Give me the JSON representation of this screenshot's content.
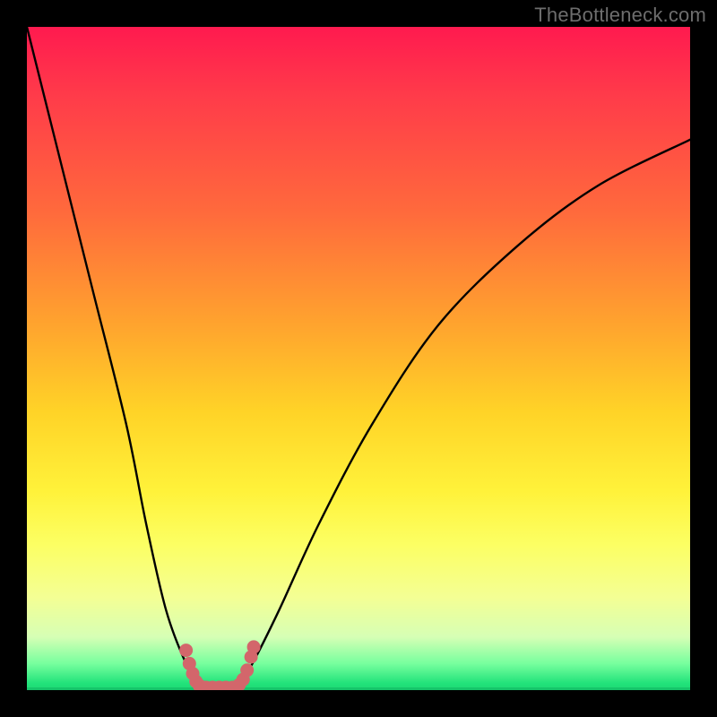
{
  "watermark": {
    "text": "TheBottleneck.com"
  },
  "chart_data": {
    "type": "line",
    "title": "",
    "xlabel": "",
    "ylabel": "",
    "xlim": [
      0,
      100
    ],
    "ylim": [
      0,
      100
    ],
    "background_gradient": {
      "direction": "vertical",
      "stops": [
        {
          "pos": 0,
          "color": "#ff1a4f"
        },
        {
          "pos": 28,
          "color": "#ff6a3c"
        },
        {
          "pos": 58,
          "color": "#ffd327"
        },
        {
          "pos": 78,
          "color": "#fcff63"
        },
        {
          "pos": 92,
          "color": "#d6ffb5"
        },
        {
          "pos": 100,
          "color": "#1fd874"
        }
      ]
    },
    "series": [
      {
        "name": "bottleneck-curve",
        "color": "#000000",
        "x": [
          0,
          5,
          10,
          15,
          18,
          21,
          24,
          26,
          28,
          30,
          32,
          34,
          38,
          44,
          52,
          62,
          74,
          86,
          100
        ],
        "values": [
          100,
          80,
          60,
          40,
          25,
          12,
          4,
          1,
          0,
          0,
          1,
          4,
          12,
          25,
          40,
          55,
          67,
          76,
          83
        ]
      }
    ],
    "markers": [
      {
        "name": "min-region-dots",
        "color": "#d3666b",
        "points": [
          {
            "x": 24.0,
            "y": 6.0
          },
          {
            "x": 24.5,
            "y": 4.0
          },
          {
            "x": 25.0,
            "y": 2.5
          },
          {
            "x": 25.5,
            "y": 1.3
          },
          {
            "x": 26.0,
            "y": 0.7
          },
          {
            "x": 27.0,
            "y": 0.4
          },
          {
            "x": 28.0,
            "y": 0.4
          },
          {
            "x": 29.0,
            "y": 0.4
          },
          {
            "x": 30.0,
            "y": 0.4
          },
          {
            "x": 31.0,
            "y": 0.4
          },
          {
            "x": 32.0,
            "y": 0.8
          },
          {
            "x": 32.6,
            "y": 1.6
          },
          {
            "x": 33.2,
            "y": 3.0
          },
          {
            "x": 33.8,
            "y": 5.0
          },
          {
            "x": 34.2,
            "y": 6.5
          }
        ]
      }
    ]
  }
}
